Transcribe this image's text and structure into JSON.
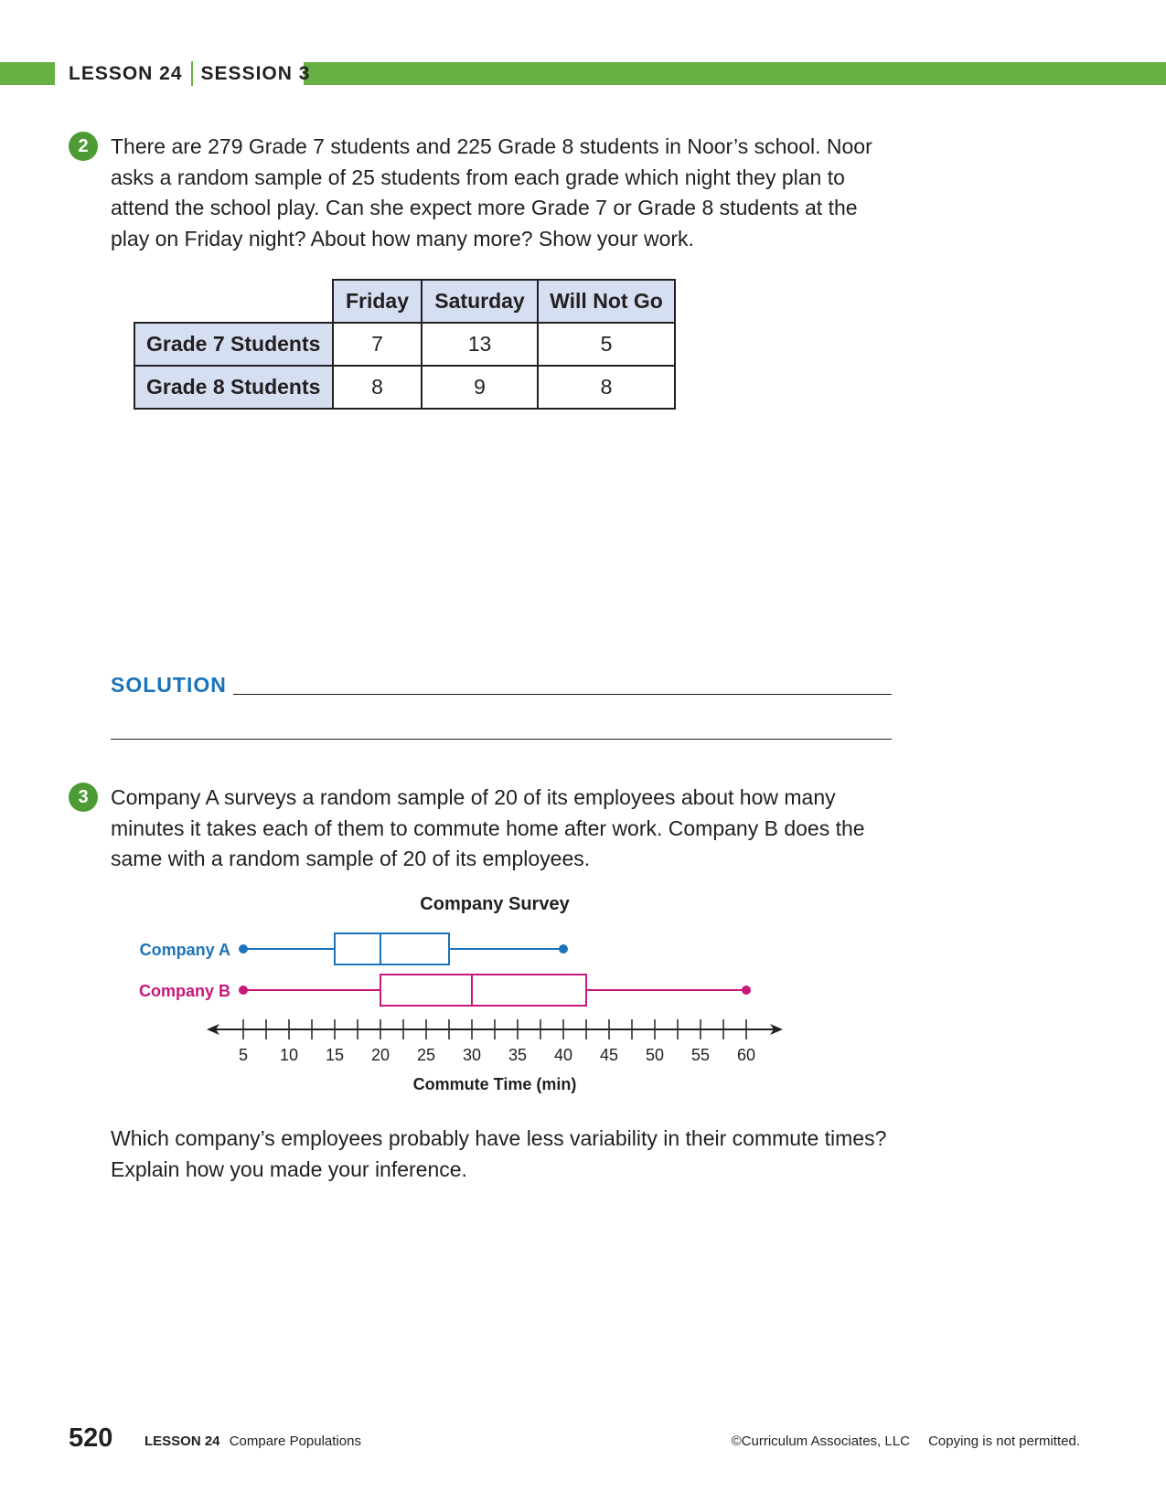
{
  "header": {
    "lesson": "LESSON 24",
    "session": "SESSION 3"
  },
  "q2": {
    "number": "2",
    "text": "There are 279 Grade 7 students and 225 Grade 8 students in Noor’s school. Noor asks a random sample of 25 students from each grade which night they plan to attend the school play. Can she expect more Grade 7 or Grade 8 students at the play on Friday night? About how many more? Show your work.",
    "table": {
      "columns": [
        "Friday",
        "Saturday",
        "Will Not Go"
      ],
      "rows": [
        {
          "label": "Grade 7 Students",
          "values": [
            "7",
            "13",
            "5"
          ]
        },
        {
          "label": "Grade 8 Students",
          "values": [
            "8",
            "9",
            "8"
          ]
        }
      ]
    },
    "solution_label": "SOLUTION"
  },
  "q3": {
    "number": "3",
    "text": "Company A surveys a random sample of 20 of its employees about how many minutes it takes each of them to commute home after work. Company B does the same with a random sample of 20 of its employees.",
    "followup": "Which company’s employees probably have less variability in their commute times? Explain how you made your inference."
  },
  "chart_data": {
    "type": "boxplot",
    "title": "Company Survey",
    "xlabel": "Commute Time (min)",
    "xlim": [
      5,
      60
    ],
    "ticks": [
      5,
      10,
      15,
      20,
      25,
      30,
      35,
      40,
      45,
      50,
      55,
      60
    ],
    "minor_step": 2.5,
    "series": [
      {
        "name": "Company A",
        "color": "#1a73ba",
        "min": 5,
        "q1": 15,
        "median": 20,
        "q3": 27.5,
        "max": 40
      },
      {
        "name": "Company B",
        "color": "#c8177a",
        "min": 5,
        "q1": 20,
        "median": 30,
        "q3": 42.5,
        "max": 60
      }
    ]
  },
  "footer": {
    "page_number": "520",
    "lesson_label": "LESSON 24",
    "lesson_title": "Compare Populations",
    "copyright": "©Curriculum Associates, LLC",
    "notice": "Copying is not permitted."
  }
}
